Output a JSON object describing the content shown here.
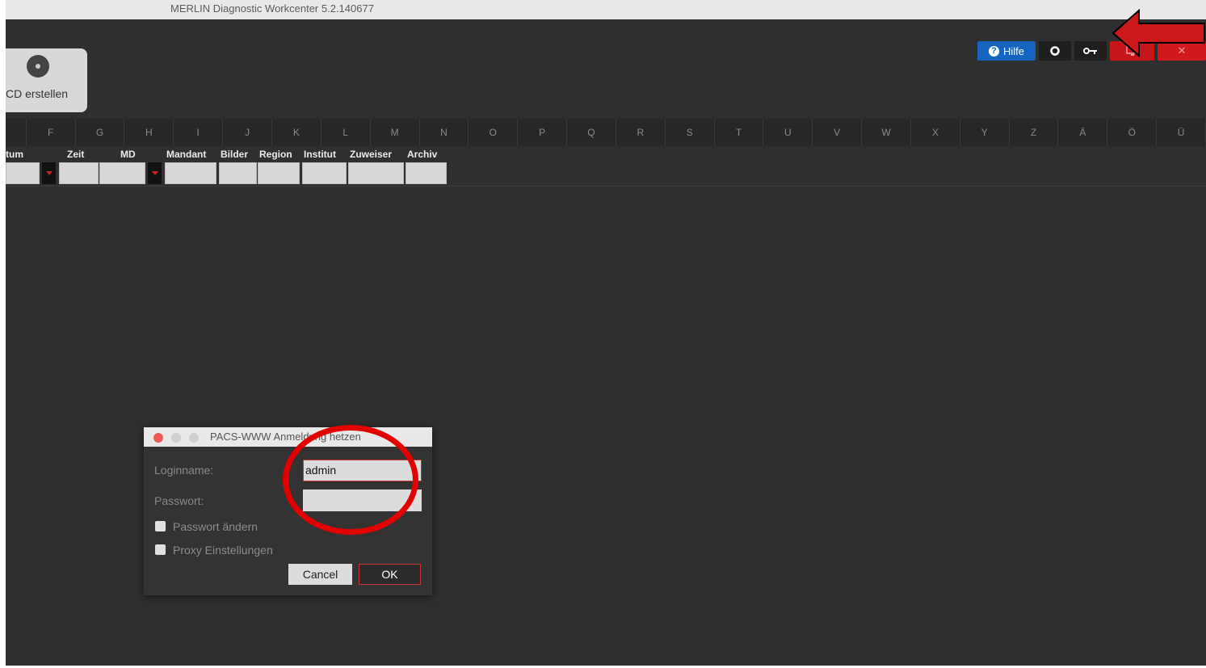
{
  "window": {
    "title": "MERLIN Diagnostic Workcenter  5.2.140677"
  },
  "toolbar": {
    "help_label": "Hilfe",
    "help_icon": "help-circle-icon",
    "settings_icon": "gear-icon",
    "login_icon": "key-icon",
    "monitor_icon": "monitor-icon",
    "close_label": "✕"
  },
  "cd_button": {
    "label": "CD erstellen",
    "icon": "disc-icon"
  },
  "alphabet": [
    "",
    "F",
    "G",
    "H",
    "I",
    "J",
    "K",
    "L",
    "M",
    "N",
    "O",
    "P",
    "Q",
    "R",
    "S",
    "T",
    "U",
    "V",
    "W",
    "X",
    "Y",
    "Z",
    "Ä",
    "Ö",
    "Ü"
  ],
  "columns": [
    "tum",
    "Zeit",
    "MD",
    "Mandant",
    "Bilder",
    "Region",
    "Institut",
    "Zuweiser",
    "Archiv"
  ],
  "dialog": {
    "title": "PACS-WWW Anmeldung hetzen",
    "login_label": "Loginname:",
    "login_value": "admin",
    "password_label": "Passwort:",
    "password_value": "",
    "change_password_label": "Passwort ändern",
    "proxy_label": "Proxy Einstellungen",
    "cancel_label": "Cancel",
    "ok_label": "OK"
  },
  "colors": {
    "accent_red": "#e30000",
    "help_blue": "#1565c0",
    "background": "#2f2f2f"
  }
}
